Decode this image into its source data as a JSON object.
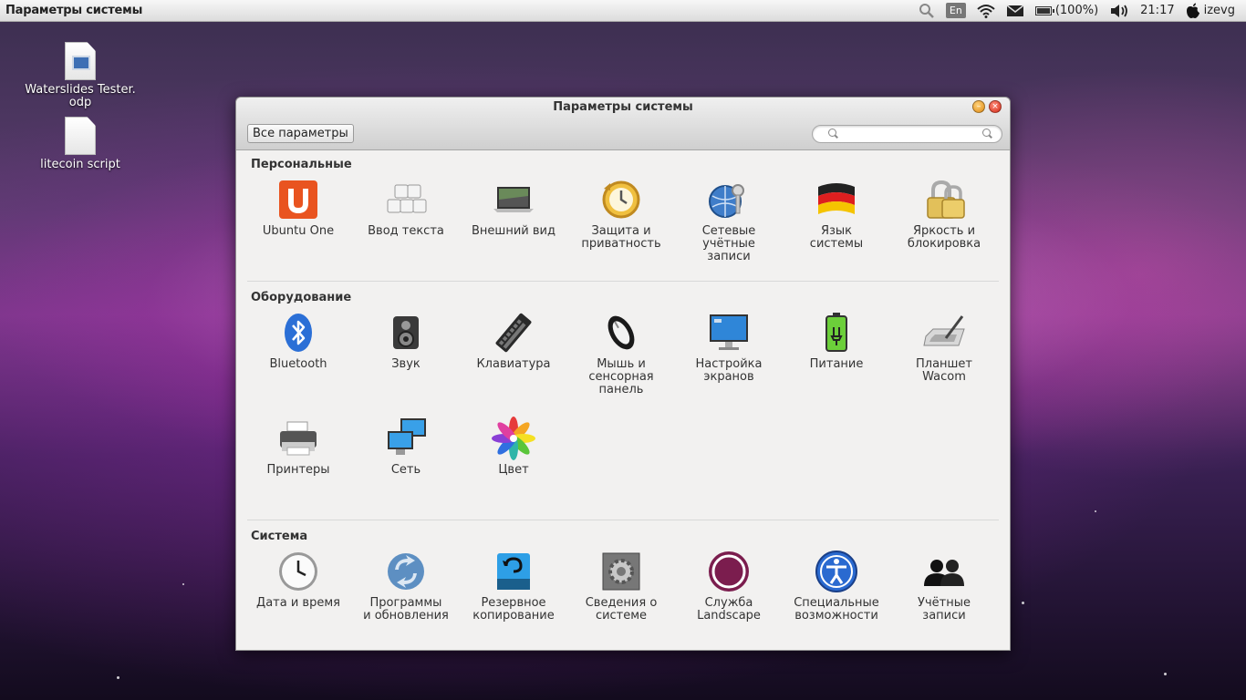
{
  "top_panel": {
    "app_name": "Параметры системы",
    "language": "En",
    "battery": "(100%)",
    "battery_level": 1.0,
    "time": "21:17",
    "user": "izevg"
  },
  "desktop": {
    "icons": [
      {
        "label": "Waterslides Tester.\nodp"
      },
      {
        "label": "litecoin script"
      }
    ]
  },
  "window": {
    "title": "Параметры системы",
    "all_settings_label": "Все параметры",
    "search_placeholder": "",
    "sections": [
      {
        "title": "Персональные",
        "items": [
          {
            "label": "Ubuntu One",
            "icon": "ubuntu-one-icon"
          },
          {
            "label": "Ввод текста",
            "icon": "keys-icon"
          },
          {
            "label": "Внешний вид",
            "icon": "laptop-icon"
          },
          {
            "label": "Защита и\nприватность",
            "icon": "clock-history-icon"
          },
          {
            "label": "Сетевые\nучётные\nзаписи",
            "icon": "globe-key-icon"
          },
          {
            "label": "Язык\nсистемы",
            "icon": "flag-icon"
          },
          {
            "label": "Яркость и\nблокировка",
            "icon": "padlock-icon"
          }
        ]
      },
      {
        "title": "Оборудование",
        "items": [
          {
            "label": "Bluetooth",
            "icon": "bluetooth-icon"
          },
          {
            "label": "Звук",
            "icon": "speaker-icon"
          },
          {
            "label": "Клавиатура",
            "icon": "keyboard-icon"
          },
          {
            "label": "Мышь и\nсенсорная\nпанель",
            "icon": "mouse-icon"
          },
          {
            "label": "Настройка\nэкранов",
            "icon": "monitor-icon"
          },
          {
            "label": "Питание",
            "icon": "battery-icon"
          },
          {
            "label": "Планшет\nWacom",
            "icon": "tablet-icon"
          },
          {
            "label": "Принтеры",
            "icon": "printer-icon"
          },
          {
            "label": "Сеть",
            "icon": "network-icon"
          },
          {
            "label": "Цвет",
            "icon": "color-wheel-icon"
          }
        ]
      },
      {
        "title": "Система",
        "items": [
          {
            "label": "Дата и время",
            "icon": "clock-icon"
          },
          {
            "label": "Программы\nи обновления",
            "icon": "updates-icon"
          },
          {
            "label": "Резервное\nкопирование",
            "icon": "backup-drive-icon"
          },
          {
            "label": "Сведения о\nсистеме",
            "icon": "gears-icon"
          },
          {
            "label": "Служба\nLandscape",
            "icon": "landscape-icon"
          },
          {
            "label": "Специальные\nвозможности",
            "icon": "accessibility-icon"
          },
          {
            "label": "Учётные\nзаписи",
            "icon": "users-icon"
          }
        ]
      }
    ]
  },
  "colors": {
    "ubuntu_orange": "#e95420",
    "bluetooth_blue": "#2b6fd6",
    "landscape_purple": "#7b1d4e"
  }
}
